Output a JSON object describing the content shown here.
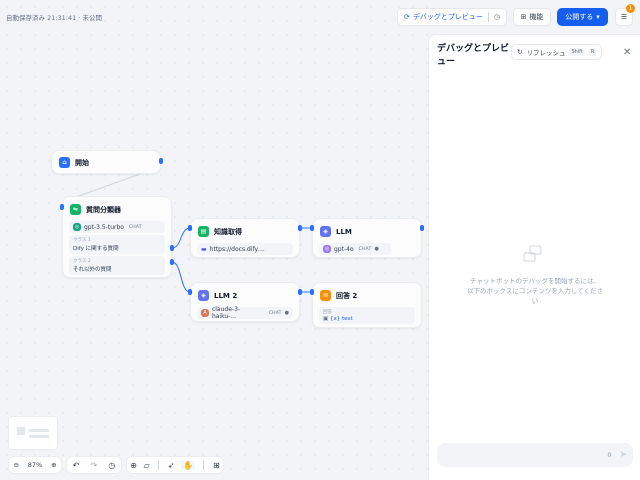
{
  "topbar": {
    "autosave": "自動保存済み 21:31:41 · 未公開",
    "debug_label": "デバッグとプレビュー",
    "function_label": "機能",
    "publish_label": "公開する",
    "notif_count": "1"
  },
  "nodes": {
    "start": {
      "title": "開始"
    },
    "classifier": {
      "title": "質問分類器",
      "model": "gpt-3.5-turbo",
      "model_tag": "CHAT",
      "classes": [
        {
          "label": "クラス 1",
          "value": "Dify に関する質問"
        },
        {
          "label": "クラス 2",
          "value": "それ以外の質問"
        }
      ]
    },
    "knowledge": {
      "title": "知識取得",
      "dataset": "https://docs.dify...."
    },
    "llm": {
      "title": "LLM",
      "model": "gpt-4o",
      "model_tag": "CHAT"
    },
    "llm2": {
      "title": "LLM 2",
      "model": "claude-3-haiku-...",
      "model_tag": "CHAT"
    },
    "answer2": {
      "title": "回答 2",
      "label": "回答",
      "value": "{x} text"
    }
  },
  "panel": {
    "title": "デバッグとプレビュー",
    "refresh_label": "リフレッシュ",
    "shortcut1": "Shift",
    "shortcut2": "R",
    "empty_text": "チャットボットのデバッグを開始するには、以下のボックスにコンテンツを入力してください",
    "input_count": "0"
  },
  "zoom": {
    "level": "87%"
  },
  "colors": {
    "accent": "#155eef",
    "start_icon": "#2970ff",
    "classifier_icon": "#16b364",
    "knowledge_icon": "#16b364",
    "llm_icon": "#6172f3",
    "answer_icon": "#f79009"
  }
}
